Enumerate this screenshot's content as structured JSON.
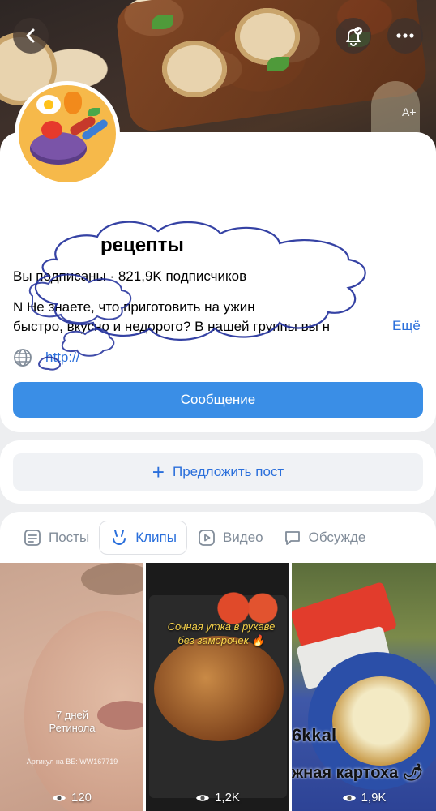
{
  "cover": {
    "aplus_label": "A+"
  },
  "community": {
    "title": "рецепты",
    "subscribed_status": "Вы подписаны · 821,9K подписчиков",
    "description_line1": "N                          Не знаете, что приготовить на ужин",
    "description_line2": "быстро, вкусно и недорого? В нашей группы вы н",
    "more_label": "Ещё",
    "link_text": "http://",
    "message_button": "Сообщение"
  },
  "suggest": {
    "label": "Предложить пост"
  },
  "tabs": [
    {
      "label": "Посты",
      "icon": "document-icon",
      "active": false
    },
    {
      "label": "Клипы",
      "icon": "clips-icon",
      "active": true
    },
    {
      "label": "Видео",
      "icon": "video-icon",
      "active": false
    },
    {
      "label": "Обсужде",
      "icon": "chat-icon",
      "active": false
    }
  ],
  "clips": [
    {
      "caption_line1": "7 дней",
      "caption_line2": "Ретинола",
      "small_text": "Артикул на ВБ: WW167719",
      "views": "120"
    },
    {
      "caption_line1": "Сочная утка в рукаве",
      "caption_line2": "без заморочек 🔥",
      "views": "1,2K"
    },
    {
      "caption_line1": "6kkal",
      "caption_line2": "жная картоха 🌶",
      "views": "1,9K"
    }
  ],
  "colors": {
    "accent": "#2a6fdb",
    "button_blue": "#3a8ee6",
    "muted": "#818c99"
  }
}
